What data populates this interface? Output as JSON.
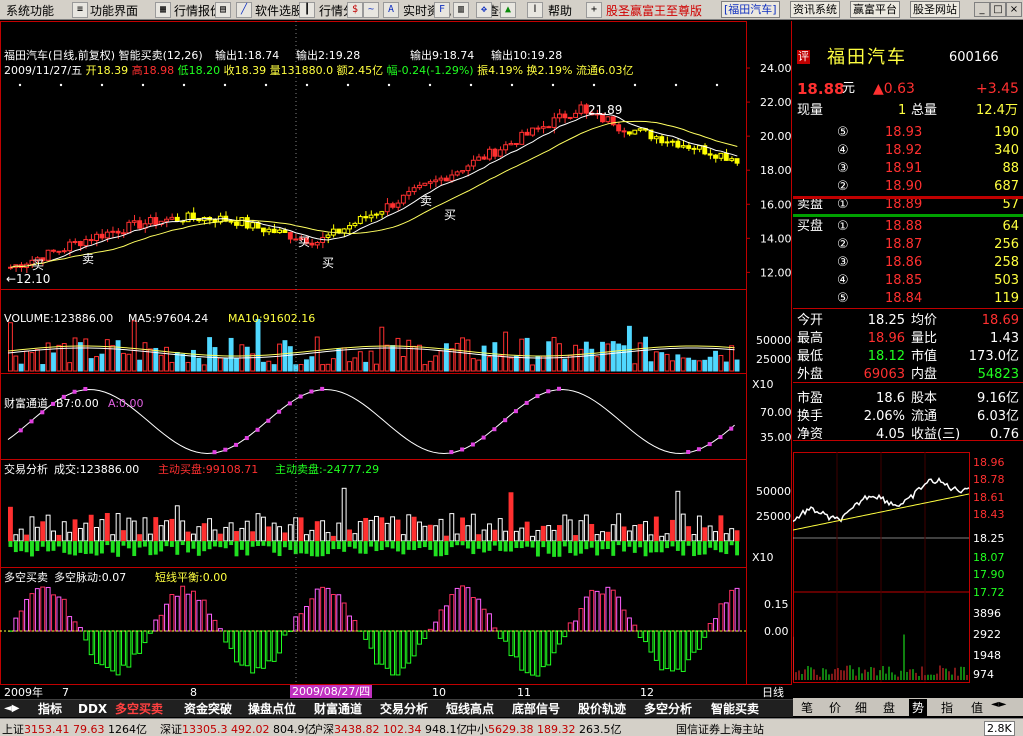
{
  "menu": {
    "items": [
      "系统功能",
      "功能界面",
      "行情报价",
      "软件选股",
      "行情分析",
      "实时资讯",
      "查看",
      "帮助"
    ],
    "toolbar_icons": [
      "sort-icon",
      "tile-icon",
      "grid-icon",
      "line-chart-icon",
      "candlestick-icon",
      "minute-icon",
      "indicator-icon",
      "f10-icon",
      "news-icon",
      "text-icon",
      "dollar-icon",
      "zoom-in-icon",
      "zoom-out-icon",
      "fit-icon",
      "move-icon",
      "left-arrow-icon",
      "up-arrow-icon",
      "down-arrow-icon"
    ],
    "brand": "股圣赢富王至尊版",
    "stock_button": "[福田汽车]",
    "buttons": [
      "资讯系统",
      "赢富平台",
      "股圣网站"
    ]
  },
  "chart_header": {
    "title": "福田汽车(日线,前复权) 智能买卖(12,26)",
    "outs": [
      "输出1:18.74",
      "输出2:19.28",
      "输出9:18.74",
      "输出10:19.28"
    ],
    "date": "2009/11/27/五",
    "open_label": "开",
    "open": "18.39",
    "high_label": "高",
    "high": "18.98",
    "low_label": "低",
    "low": "18.20",
    "close_label": "收",
    "close": "18.39",
    "vol_label": "量",
    "vol": "131880.0",
    "amt_label": "额",
    "amt": "2.45亿",
    "chg_label": "幅",
    "chg": "-0.24(-1.29%)",
    "amp_label": "振",
    "amp": "4.19%",
    "turn_label": "换",
    "turn": "2.19%",
    "float_label": "流通",
    "float": "6.03亿"
  },
  "chart_data": [
    {
      "type": "candlestick",
      "name": "price",
      "x": [
        "2009-07",
        "2009-08",
        "2009-09",
        "2009-10",
        "2009-11",
        "2009-12"
      ],
      "y_ticks": [
        12.0,
        14.0,
        16.0,
        18.0,
        20.0,
        22.0,
        24.0
      ],
      "ylim": [
        11.2,
        25.0
      ],
      "annotations": [
        "买",
        "卖",
        "买",
        "买",
        "卖",
        "买",
        "←12.10",
        "21.89"
      ]
    },
    {
      "type": "bar",
      "name": "VOLUME",
      "label": "VOLUME:123886.00",
      "ma5": "MA5:97604.24",
      "ma10": "MA10:91602.16",
      "y_ticks": [
        "50000",
        "25000"
      ],
      "scale": "X10"
    },
    {
      "type": "line",
      "name": "财富通道",
      "label": "财富通道",
      "b7": "B7:0.00",
      "a": "A:0.00",
      "y_ticks": [
        "70.00",
        "35.00"
      ]
    },
    {
      "type": "bar",
      "name": "交易分析",
      "label": "交易分析",
      "vol": "成交:123886.00",
      "buy": "主动买盘:99108.71",
      "sell": "主动卖盘:-24777.29",
      "y_ticks": [
        "50000",
        "25000"
      ],
      "scale": "X10"
    },
    {
      "type": "bar",
      "name": "多空买卖",
      "label": "多空买卖",
      "pulse": "多空脉动:0.07",
      "balance": "短线平衡:0.00",
      "y_ticks": [
        "0.15",
        "0.00"
      ]
    }
  ],
  "x_axis": {
    "year": "2009年",
    "months": [
      "7",
      "8",
      "9",
      "10",
      "11",
      "12"
    ],
    "cursor": "2009/08/27/四",
    "right": "日线"
  },
  "quote": {
    "flag": "评",
    "name": "福田汽车",
    "code": "600166",
    "price": "18.88",
    "price_unit": "元",
    "change": "▲0.63",
    "pct": "+3.45",
    "now_vol_label": "现量",
    "now_vol": "1",
    "total_vol_label": "总量",
    "total_vol": "12.4万",
    "sells": [
      {
        "n": "⑤",
        "p": "18.93",
        "v": "190"
      },
      {
        "n": "④",
        "p": "18.92",
        "v": "340"
      },
      {
        "n": "③",
        "p": "18.91",
        "v": "88"
      },
      {
        "n": "②",
        "p": "18.90",
        "v": "687"
      },
      {
        "n": "①",
        "p": "18.89",
        "v": "57",
        "label": "卖盘"
      }
    ],
    "buys": [
      {
        "n": "①",
        "p": "18.88",
        "v": "64",
        "label": "买盘"
      },
      {
        "n": "②",
        "p": "18.87",
        "v": "256"
      },
      {
        "n": "③",
        "p": "18.86",
        "v": "258"
      },
      {
        "n": "④",
        "p": "18.85",
        "v": "503"
      },
      {
        "n": "⑤",
        "p": "18.84",
        "v": "119"
      }
    ],
    "stats": [
      {
        "l1": "今开",
        "v1": "18.25",
        "l2": "均价",
        "v2": "18.69",
        "c1": "hl",
        "c2": "red"
      },
      {
        "l1": "最高",
        "v1": "18.96",
        "l2": "量比",
        "v2": "1.43",
        "c1": "red",
        "c2": "hl"
      },
      {
        "l1": "最低",
        "v1": "18.12",
        "l2": "市值",
        "v2": "173.0亿",
        "c1": "grn",
        "c2": "hl"
      },
      {
        "l1": "外盘",
        "v1": "69063",
        "l2": "内盘",
        "v2": "54823",
        "c1": "red",
        "c2": "grn"
      },
      {
        "l1": "市盈",
        "v1": "18.6",
        "l2": "股本",
        "v2": "9.16亿",
        "c1": "hl",
        "c2": "hl"
      },
      {
        "l1": "换手",
        "v1": "2.06%",
        "l2": "流通",
        "v2": "6.03亿",
        "c1": "hl",
        "c2": "hl"
      },
      {
        "l1": "净资",
        "v1": "4.05",
        "l2": "收益(三)",
        "v2": "0.76",
        "c1": "hl",
        "c2": "hl"
      }
    ]
  },
  "intraday": {
    "y_ticks": [
      "18.96",
      "18.78",
      "18.61",
      "18.43",
      "18.25",
      "18.07",
      "17.90",
      "17.72",
      "3896",
      "2922",
      "1948",
      "974"
    ]
  },
  "right_tabs": [
    "笔",
    "价",
    "细",
    "盘",
    "势",
    "指",
    "值"
  ],
  "bottom_tabs": [
    "指标",
    "DDX",
    "多空买卖",
    "资金突破",
    "操盘点位",
    "财富通道",
    "交易分析",
    "短线高点",
    "底部信号",
    "股价轨迹",
    "多空分析",
    "智能买卖"
  ],
  "status": {
    "sh_label": "上证",
    "sh": "3153.41",
    "sh_chg": "79.63",
    "sh_amt": "1264亿",
    "sz_label": "深证",
    "sz": "13305.3",
    "sz_chg": "492.02",
    "sz_amt": "804.9亿",
    "hs_label": "沪深",
    "hs": "3438.82",
    "hs_chg": "102.34",
    "hs_amt": "948.1亿",
    "zx_label": "中小",
    "zx": "5629.38",
    "zx_chg": "189.32",
    "zx_amt": "263.5亿",
    "server": "国信证券上海主站",
    "speed": "2.8K"
  },
  "colors": {
    "up": "#ff3030",
    "down": "#50d8ff",
    "hl": "#ffffff",
    "accent": "#ffff40"
  }
}
